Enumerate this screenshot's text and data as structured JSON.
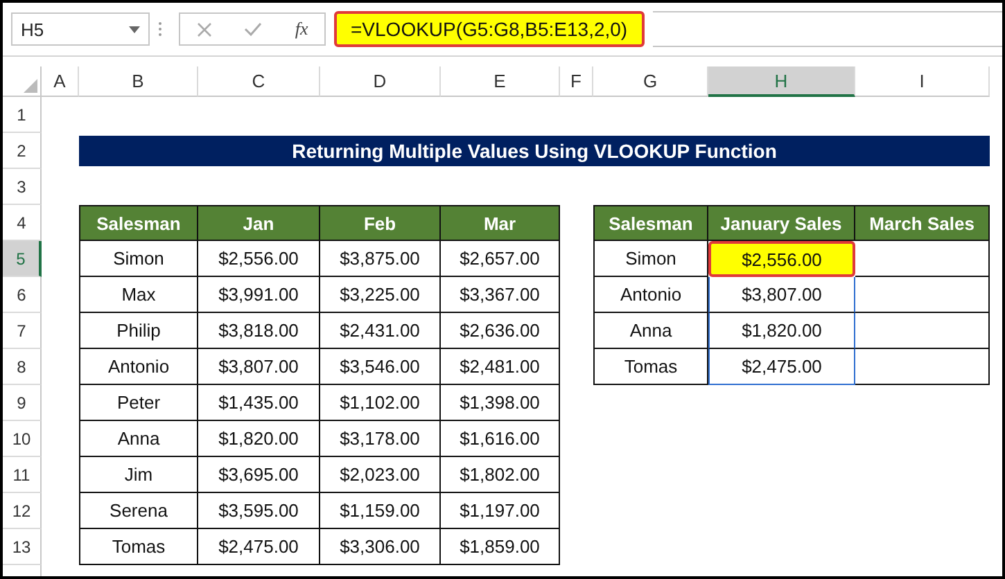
{
  "formula_bar": {
    "name_box": "H5",
    "function_label": "fx",
    "formula": "=VLOOKUP(G5:G8,B5:E13,2,0)"
  },
  "column_headers": [
    {
      "label": "A",
      "selected": false
    },
    {
      "label": "B",
      "selected": false
    },
    {
      "label": "C",
      "selected": false
    },
    {
      "label": "D",
      "selected": false
    },
    {
      "label": "E",
      "selected": false
    },
    {
      "label": "F",
      "selected": false
    },
    {
      "label": "G",
      "selected": false
    },
    {
      "label": "H",
      "selected": true
    },
    {
      "label": "I",
      "selected": false
    }
  ],
  "row_headers": [
    {
      "label": "1",
      "selected": false
    },
    {
      "label": "2",
      "selected": false
    },
    {
      "label": "3",
      "selected": false
    },
    {
      "label": "4",
      "selected": false
    },
    {
      "label": "5",
      "selected": true
    },
    {
      "label": "6",
      "selected": false
    },
    {
      "label": "7",
      "selected": false
    },
    {
      "label": "8",
      "selected": false
    },
    {
      "label": "9",
      "selected": false
    },
    {
      "label": "10",
      "selected": false
    },
    {
      "label": "11",
      "selected": false
    },
    {
      "label": "12",
      "selected": false
    },
    {
      "label": "13",
      "selected": false
    }
  ],
  "title": "Returning Multiple Values Using VLOOKUP Function",
  "sales_table": {
    "columns": [
      "Salesman",
      "Jan",
      "Feb",
      "Mar"
    ],
    "rows": [
      [
        "Simon",
        "$2,556.00",
        "$3,875.00",
        "$2,657.00"
      ],
      [
        "Max",
        "$3,991.00",
        "$3,225.00",
        "$3,367.00"
      ],
      [
        "Philip",
        "$3,818.00",
        "$2,431.00",
        "$2,636.00"
      ],
      [
        "Antonio",
        "$3,807.00",
        "$3,546.00",
        "$2,481.00"
      ],
      [
        "Peter",
        "$1,435.00",
        "$1,102.00",
        "$1,398.00"
      ],
      [
        "Anna",
        "$1,820.00",
        "$3,178.00",
        "$1,616.00"
      ],
      [
        "Jim",
        "$3,695.00",
        "$2,023.00",
        "$1,802.00"
      ],
      [
        "Serena",
        "$3,595.00",
        "$1,159.00",
        "$1,197.00"
      ],
      [
        "Tomas",
        "$2,475.00",
        "$3,306.00",
        "$1,859.00"
      ]
    ]
  },
  "lookup_table": {
    "columns": [
      "Salesman",
      "January Sales",
      "March Sales"
    ],
    "rows": [
      {
        "salesman": "Simon",
        "january_sales": "$2,556.00",
        "highlighted": true
      },
      {
        "salesman": "Antonio",
        "january_sales": "$3,807.00",
        "highlighted": false
      },
      {
        "salesman": "Anna",
        "january_sales": "$1,820.00",
        "highlighted": false
      },
      {
        "salesman": "Tomas",
        "january_sales": "$2,475.00",
        "highlighted": false
      }
    ]
  }
}
